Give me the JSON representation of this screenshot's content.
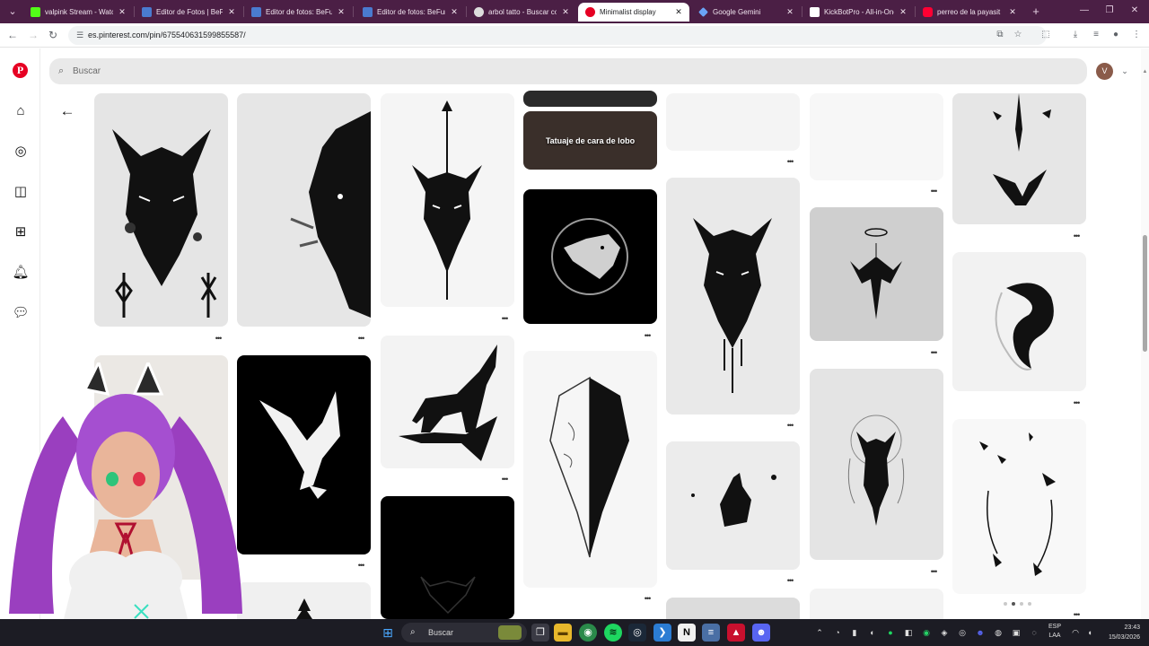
{
  "browser": {
    "tabs": [
      {
        "label": "valpink Stream - Watch",
        "favicon_color": "#53fc18",
        "active": false
      },
      {
        "label": "Editor de Fotos | BeFunky",
        "favicon_color": "#4a7bd0",
        "active": false
      },
      {
        "label": "Editor de fotos: BeFunky",
        "favicon_color": "#4a7bd0",
        "active": false
      },
      {
        "label": "Editor de fotos: BeFunky",
        "favicon_color": "#4a7bd0",
        "active": false
      },
      {
        "label": "arbol tatto - Buscar con",
        "favicon_color": "#dddddd",
        "active": false
      },
      {
        "label": "Minimalist display",
        "favicon_color": "#e60023",
        "active": true
      },
      {
        "label": "Google Gemini",
        "favicon_color": "#6aa3f5",
        "active": false
      },
      {
        "label": "KickBotPro - All-in-One",
        "favicon_color": "#ffffff",
        "active": false
      },
      {
        "label": "perreo de la payasit",
        "favicon_color": "#ff0033",
        "active": false
      }
    ],
    "tab_close_glyph": "✕",
    "new_tab_glyph": "+",
    "url": "es.pinterest.com/pin/675540631599855587/"
  },
  "pinterest": {
    "search_placeholder": "Buscar",
    "avatar_initial": "V",
    "pin_caption": "Tatuaje de cara de lobo",
    "sidebar_icons": [
      "pinterest-logo",
      "home-icon",
      "explore-icon",
      "boards-icon",
      "create-icon",
      "notifications-icon",
      "messages-icon",
      "settings-icon"
    ]
  },
  "taskbar": {
    "search_label": "Buscar",
    "lang_line1": "ESP",
    "lang_line2": "LAA",
    "time": "23:43",
    "date": "15/03/2026"
  },
  "colors": {
    "tabstrip": "#4b1f45",
    "pinterest_red": "#e60023",
    "taskbar": "#1c1c24"
  }
}
